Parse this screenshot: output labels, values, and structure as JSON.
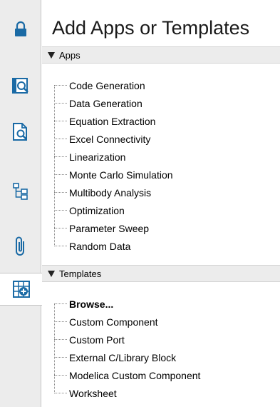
{
  "rail": {
    "buttons": [
      {
        "name": "lock-icon",
        "active": false
      },
      {
        "name": "library-search-icon",
        "active": false
      },
      {
        "name": "document-search-icon",
        "active": false
      },
      {
        "name": "hierarchy-icon",
        "active": false
      },
      {
        "name": "paperclip-icon",
        "active": false
      },
      {
        "name": "add-apps-icon",
        "active": true
      }
    ],
    "accent": "#1a6aa5"
  },
  "panel": {
    "title": "Add Apps or Templates",
    "apps": {
      "header": "Apps",
      "items": [
        "Code Generation",
        "Data Generation",
        "Equation Extraction",
        "Excel Connectivity",
        "Linearization",
        "Monte Carlo Simulation",
        "Multibody Analysis",
        "Optimization",
        "Parameter Sweep",
        "Random Data"
      ]
    },
    "templates": {
      "header": "Templates",
      "items": [
        "Browse...",
        "Custom Component",
        "Custom Port",
        "External C/Library Block",
        "Modelica Custom Component",
        "Worksheet"
      ]
    }
  }
}
